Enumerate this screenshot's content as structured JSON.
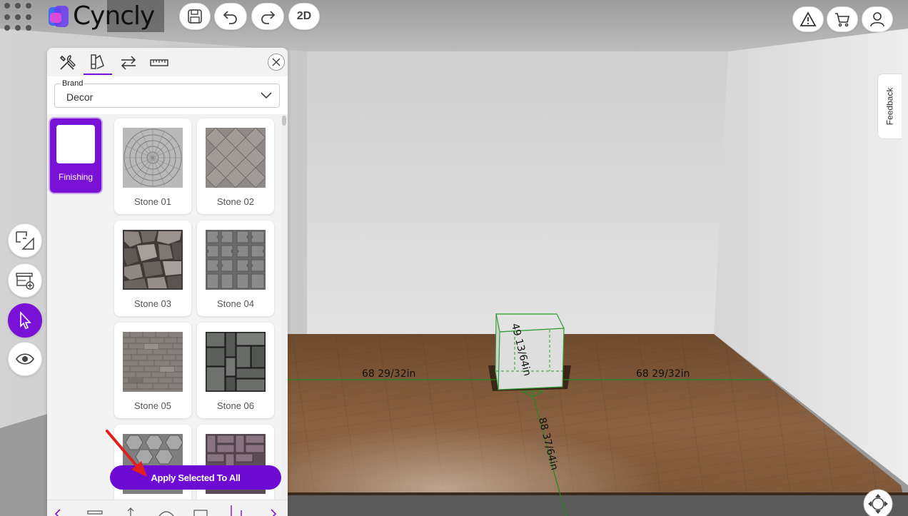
{
  "app": {
    "logo_text": "Cyncly",
    "view_toggle_label": "2D",
    "feedback_label": "Feedback"
  },
  "topbar": {
    "save_icon": "save-icon",
    "undo_icon": "undo-icon",
    "redo_icon": "redo-icon",
    "warning_icon": "warning-icon",
    "cart_icon": "cart-icon",
    "user_icon": "user-icon"
  },
  "side_tools": [
    "floorplan-icon",
    "add-furniture-icon",
    "select-cursor-icon",
    "view-eye-icon"
  ],
  "panel": {
    "tabs": [
      "tools-icon",
      "materials-icon",
      "swap-icon",
      "measure-icon"
    ],
    "active_tab": 1,
    "brand_label": "Brand",
    "brand_value": "Decor",
    "category": "Finishing",
    "tiles": [
      {
        "name": "Stone 01",
        "pattern": "circular-paving"
      },
      {
        "name": "Stone 02",
        "pattern": "granite-paving"
      },
      {
        "name": "Stone 03",
        "pattern": "flagstone"
      },
      {
        "name": "Stone 04",
        "pattern": "interlock-paving"
      },
      {
        "name": "Stone 05",
        "pattern": "small-cobble"
      },
      {
        "name": "Stone 06",
        "pattern": "slate-blocks"
      },
      {
        "name": "",
        "pattern": "hex-paving"
      },
      {
        "name": "",
        "pattern": "brick-paving"
      }
    ],
    "apply_label": "Apply Selected To All"
  },
  "scene": {
    "dimension_left": "68 29/32in",
    "dimension_right": "68 29/32in",
    "dimension_height": "49 13/64in",
    "dimension_depth": "88 37/64in"
  },
  "colors": {
    "accent": "#7a11d6",
    "wall": "#d8d8d8",
    "floor": "#7a5334",
    "dimension_line": "#1f8a1f"
  }
}
